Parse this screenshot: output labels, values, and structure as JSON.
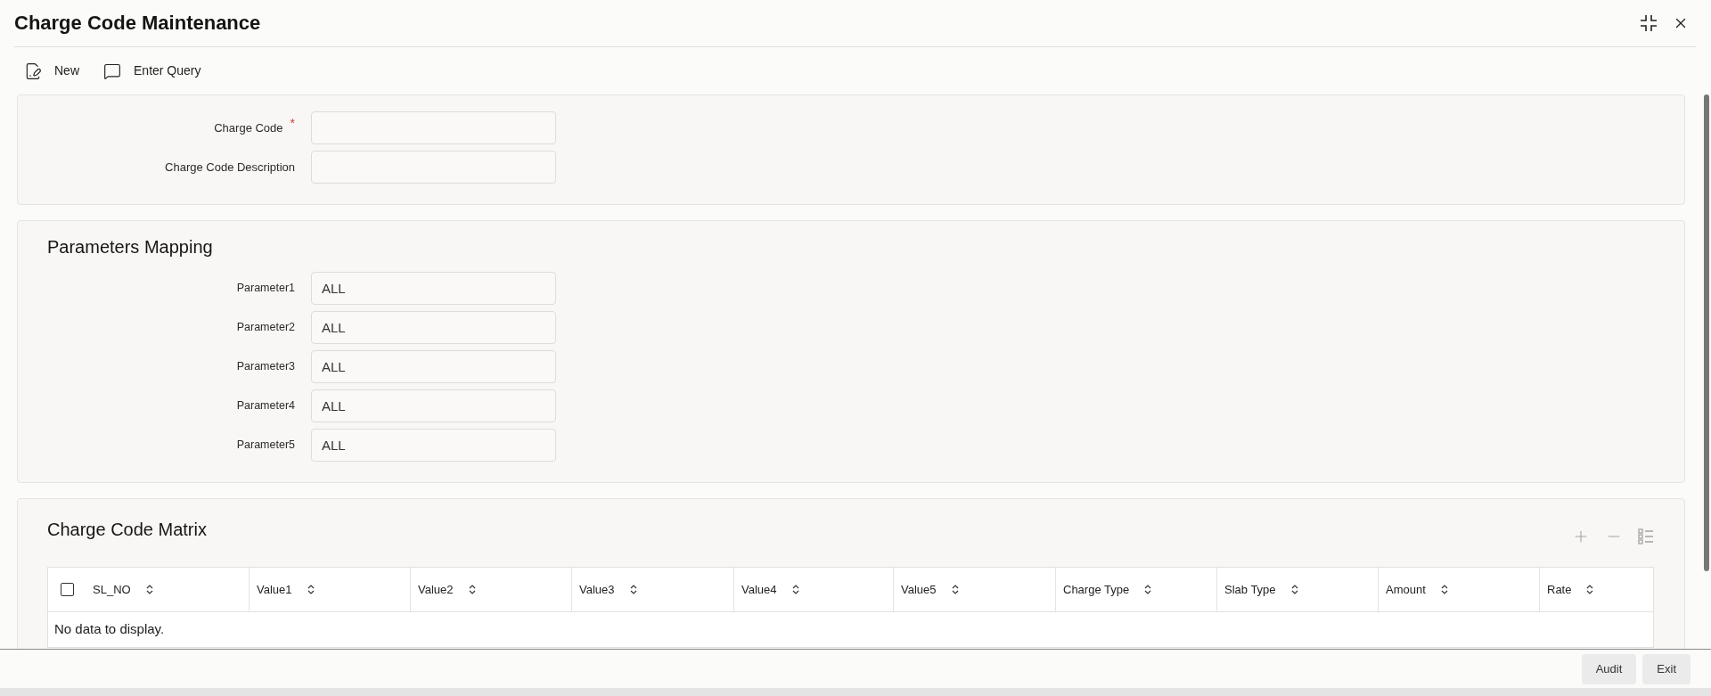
{
  "window": {
    "title": "Charge Code Maintenance"
  },
  "toolbar": [
    {
      "kind": "new",
      "label": "New"
    },
    {
      "kind": "query",
      "label": "Enter Query"
    }
  ],
  "main_section": {
    "fields": [
      {
        "label": "Charge Code",
        "required_mark": "*"
      },
      {
        "label": "Charge Code Description"
      }
    ]
  },
  "parameters_mapping": {
    "title": "Parameters Mapping",
    "fields": [
      {
        "label": "Parameter1",
        "value": "ALL"
      },
      {
        "label": "Parameter2",
        "value": "ALL"
      },
      {
        "label": "Parameter3",
        "value": "ALL"
      },
      {
        "label": "Parameter4",
        "value": "ALL"
      },
      {
        "label": "Parameter5",
        "value": "ALL"
      }
    ]
  },
  "charge_code_matrix": {
    "title": "Charge Code Matrix",
    "actions": [
      {
        "kind": "add",
        "disabled": true
      },
      {
        "kind": "remove",
        "disabled": true
      },
      {
        "kind": "columns",
        "disabled": true
      }
    ],
    "table": {
      "select_all": {
        "checked": false
      },
      "columns": [
        "SL_NO",
        "Value1",
        "Value2",
        "Value3",
        "Value4",
        "Value5",
        "Charge Type",
        "Slab Type",
        "Amount",
        "Rate"
      ],
      "empty_message": "No data to display."
    }
  },
  "footer": {
    "buttons": [
      "Audit",
      "Exit"
    ]
  }
}
